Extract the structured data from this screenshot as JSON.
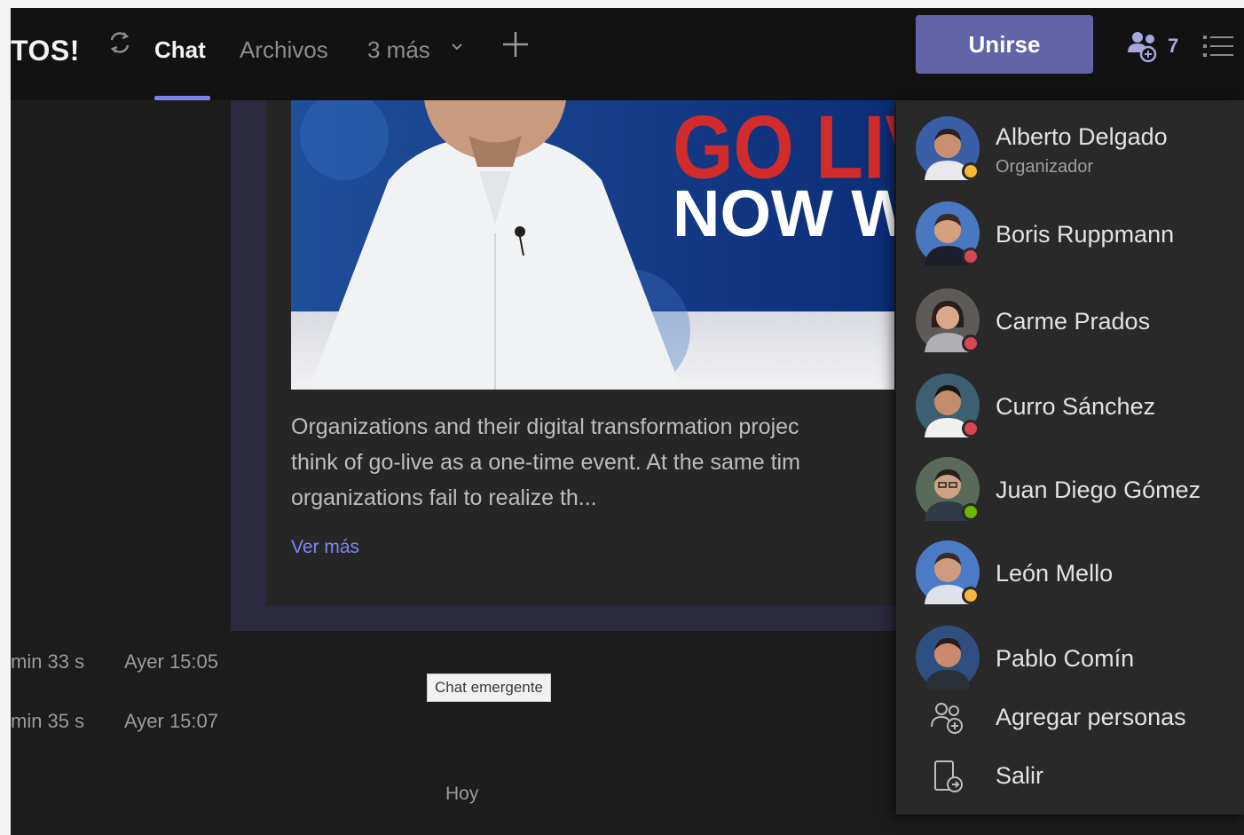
{
  "header": {
    "title": "TOS!",
    "tabs": [
      {
        "label": "Chat",
        "active": true
      },
      {
        "label": "Archivos",
        "active": false
      },
      {
        "label": "3 más",
        "active": false
      }
    ],
    "join_label": "Unirse",
    "participant_count": "7"
  },
  "post": {
    "image_text_line1": "GO LIV",
    "image_text_line2": "NOW WH",
    "body": "Organizations and their digital transformation projec\nthink of go-live as a one-time event. At the same tim\norganizations fail to realize th...",
    "see_more": "Ver más"
  },
  "calls": [
    {
      "duration": "min 33 s",
      "when": "Ayer 15:05"
    },
    {
      "duration": "min 35 s",
      "when": "Ayer 15:07"
    }
  ],
  "tooltip": "Chat emergente",
  "date_divider": "Hoy",
  "participants": [
    {
      "name": "Alberto Delgado",
      "role": "Organizador",
      "status": "away",
      "status_color": "#f8b73a"
    },
    {
      "name": "Boris Ruppmann",
      "role": "",
      "status": "busy",
      "status_color": "#d74654"
    },
    {
      "name": "Carme Prados",
      "role": "",
      "status": "busy",
      "status_color": "#d74654"
    },
    {
      "name": "Curro Sánchez",
      "role": "",
      "status": "busy",
      "status_color": "#d74654"
    },
    {
      "name": "Juan Diego Gómez",
      "role": "",
      "status": "available",
      "status_color": "#6bb700"
    },
    {
      "name": "León Mello",
      "role": "",
      "status": "away",
      "status_color": "#f8b73a"
    },
    {
      "name": "Pablo Comín",
      "role": "",
      "status": "none",
      "status_color": ""
    }
  ],
  "actions": [
    {
      "label": "Agregar personas",
      "icon": "add-people-icon"
    },
    {
      "label": "Salir",
      "icon": "leave-icon"
    }
  ],
  "colors": {
    "accent": "#6264a7",
    "link": "#7f85f5",
    "background": "#1f1f1f"
  }
}
